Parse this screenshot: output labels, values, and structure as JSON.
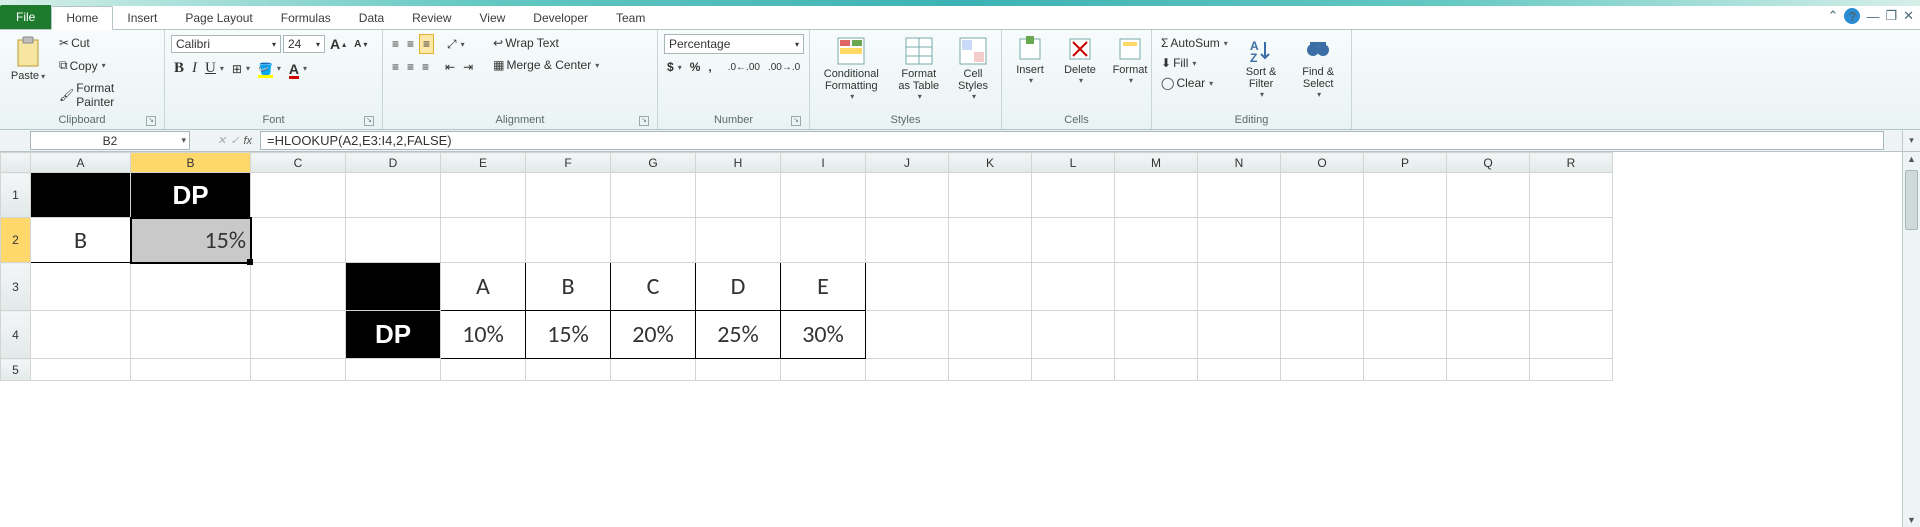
{
  "tabs": {
    "file": "File",
    "items": [
      "Home",
      "Insert",
      "Page Layout",
      "Formulas",
      "Data",
      "Review",
      "View",
      "Developer",
      "Team"
    ],
    "active": "Home"
  },
  "ribbon": {
    "clipboard": {
      "label": "Clipboard",
      "paste": "Paste",
      "cut": "Cut",
      "copy": "Copy",
      "fmtpainter": "Format Painter"
    },
    "font": {
      "label": "Font",
      "name": "Calibri",
      "size": "24"
    },
    "alignment": {
      "label": "Alignment",
      "wrap": "Wrap Text",
      "merge": "Merge & Center"
    },
    "number": {
      "label": "Number",
      "format": "Percentage"
    },
    "styles": {
      "label": "Styles",
      "cond": "Conditional Formatting",
      "table": "Format as Table",
      "cell": "Cell Styles"
    },
    "cells": {
      "label": "Cells",
      "insert": "Insert",
      "delete": "Delete",
      "format": "Format"
    },
    "editing": {
      "label": "Editing",
      "autosum": "AutoSum",
      "fill": "Fill",
      "clear": "Clear",
      "sort": "Sort & Filter",
      "find": "Find & Select"
    }
  },
  "formula_bar": {
    "cell_ref": "B2",
    "formula": "=HLOOKUP(A2,E3:I4,2,FALSE)"
  },
  "columns": [
    "A",
    "B",
    "C",
    "D",
    "E",
    "F",
    "G",
    "H",
    "I",
    "J",
    "K",
    "L",
    "M",
    "N",
    "O",
    "P",
    "Q",
    "R"
  ],
  "rows": [
    "1",
    "2",
    "3",
    "4",
    "5"
  ],
  "selected_col": "B",
  "selected_row": "2",
  "cells": {
    "B1": "DP",
    "A2": "B",
    "B2": "15%",
    "D4": "DP",
    "E3": "A",
    "F3": "B",
    "G3": "C",
    "H3": "D",
    "I3": "E",
    "E4": "10%",
    "F4": "15%",
    "G4": "20%",
    "H4": "25%",
    "I4": "30%"
  },
  "chart_data": {
    "type": "table",
    "title": "DP lookup table",
    "categories": [
      "A",
      "B",
      "C",
      "D",
      "E"
    ],
    "series": [
      {
        "name": "DP",
        "values": [
          "10%",
          "15%",
          "20%",
          "25%",
          "30%"
        ]
      }
    ]
  }
}
